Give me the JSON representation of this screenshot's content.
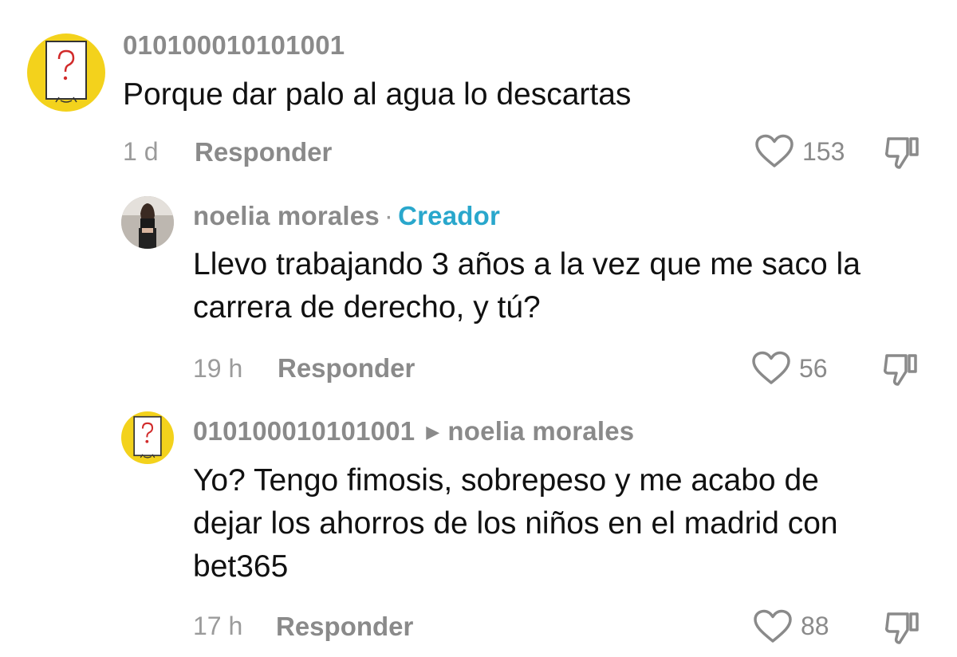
{
  "comments": [
    {
      "username": "010100010101001",
      "text_lines": [
        "Porque dar palo al agua lo descartas"
      ],
      "time": "1 d",
      "reply_label": "Responder",
      "likes": "153",
      "avatar_icon": "question-mark-paper-avatar"
    },
    {
      "username": "noelia morales",
      "separator": "·",
      "badge": "Creador",
      "text_lines": [
        "Llevo trabajando 3 años a la vez que me saco la",
        "carrera de derecho, y tú?"
      ],
      "time": "19 h",
      "reply_label": "Responder",
      "likes": "56",
      "avatar_icon": "profile-photo-avatar"
    },
    {
      "username": "010100010101001",
      "reply_to": "noelia morales",
      "text_lines": [
        "Yo? Tengo fimosis, sobrepeso y me acabo de",
        "dejar los ahorros de los niños en el madrid con",
        "bet365"
      ],
      "time": "17 h",
      "reply_label": "Responder",
      "likes": "88",
      "avatar_icon": "question-mark-paper-avatar"
    }
  ],
  "icons": {
    "like": "heart-outline-icon",
    "dislike": "thumbs-down-icon",
    "reply_arrow": "triangle-right-icon"
  },
  "colors": {
    "avatar_yellow": "#f3d21c",
    "creator_badge": "#29a7cc",
    "question_mark": "#d12a2a"
  }
}
